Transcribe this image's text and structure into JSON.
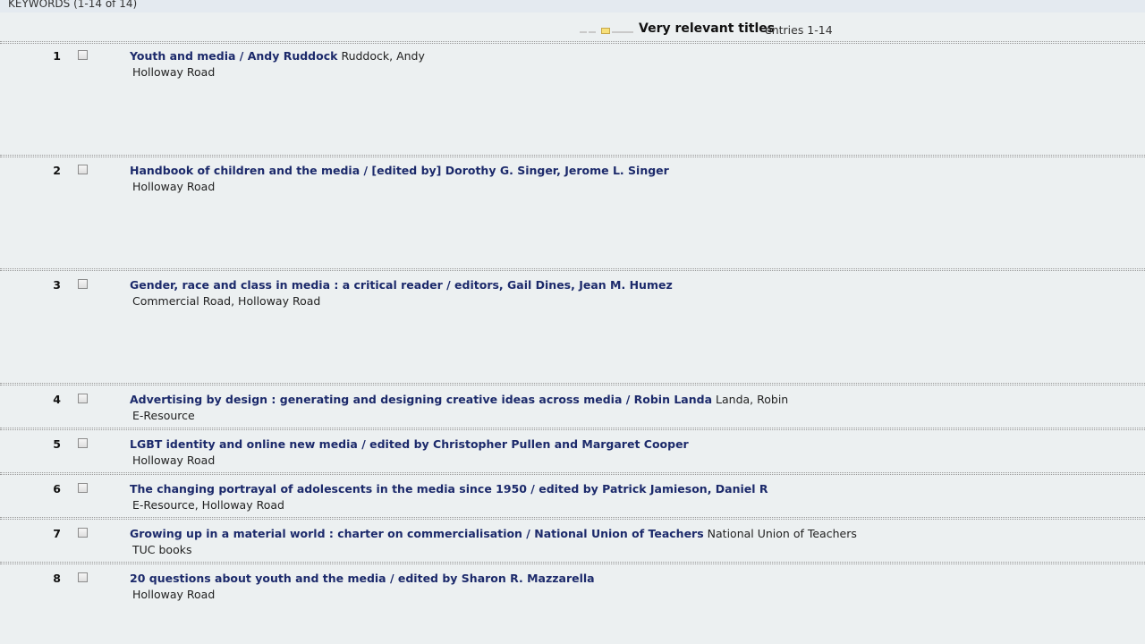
{
  "header": {
    "keywords_label": "KEYWORDS (1-14 of 14)",
    "relevance_title": "Very relevant titles",
    "entries_label": "entries 1-14"
  },
  "results": [
    {
      "num": "1",
      "title": "Youth and media / Andy Ruddock",
      "author": "Ruddock, Andy",
      "location": "Holloway Road"
    },
    {
      "num": "2",
      "title": "Handbook of children and the media / [edited by] Dorothy G. Singer, Jerome L. Singer",
      "author": "",
      "location": "Holloway Road"
    },
    {
      "num": "3",
      "title": "Gender, race and class in media : a critical reader / editors, Gail Dines, Jean M. Humez",
      "author": "",
      "location": "Commercial Road, Holloway Road"
    },
    {
      "num": "4",
      "title": "Advertising by design : generating and designing creative ideas across media / Robin Landa",
      "author": "Landa, Robin",
      "location": "E-Resource"
    },
    {
      "num": "5",
      "title": "LGBT identity and online new media / edited by Christopher Pullen and Margaret Cooper",
      "author": "",
      "location": "Holloway Road"
    },
    {
      "num": "6",
      "title": "The changing portrayal of adolescents in the media since 1950 / edited by Patrick Jamieson, Daniel R",
      "author": "",
      "location": "E-Resource, Holloway Road"
    },
    {
      "num": "7",
      "title": "Growing up in a material world : charter on commercialisation / National Union of Teachers",
      "author": "National Union of Teachers",
      "location": "TUC books"
    },
    {
      "num": "8",
      "title": "20 questions about youth and the media / edited by Sharon R. Mazzarella",
      "author": "",
      "location": "Holloway Road"
    }
  ]
}
